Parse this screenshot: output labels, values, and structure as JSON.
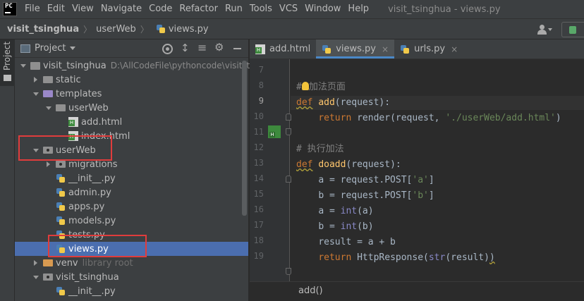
{
  "menubar": {
    "items": [
      "File",
      "Edit",
      "View",
      "Navigate",
      "Code",
      "Refactor",
      "Run",
      "Tools",
      "VCS",
      "Window",
      "Help"
    ],
    "window_title": "visit_tsinghua - views.py",
    "logo_text": "PC"
  },
  "breadcrumb": {
    "project": "visit_tsinghua",
    "folder": "userWeb",
    "file": "views.py"
  },
  "project_panel": {
    "title": "Project",
    "tool_tab_label": "Project",
    "tree": [
      {
        "label": "visit_tsinghua",
        "hint": "D:\\AllCodeFile\\pythoncode\\visit_ts",
        "depth": 0,
        "arrow": "down",
        "icon": "folder-root"
      },
      {
        "label": "static",
        "depth": 1,
        "arrow": "right",
        "icon": "folder"
      },
      {
        "label": "templates",
        "depth": 1,
        "arrow": "down",
        "icon": "folder-purple"
      },
      {
        "label": "userWeb",
        "depth": 2,
        "arrow": "down",
        "icon": "folder"
      },
      {
        "label": "add.html",
        "depth": 3,
        "arrow": "none",
        "icon": "html"
      },
      {
        "label": "index.html",
        "depth": 3,
        "arrow": "none",
        "icon": "html"
      },
      {
        "label": "userWeb",
        "depth": 1,
        "arrow": "down",
        "icon": "folder-pkg"
      },
      {
        "label": "migrations",
        "depth": 2,
        "arrow": "right",
        "icon": "folder-pkg"
      },
      {
        "label": "__init__.py",
        "depth": 2,
        "arrow": "none",
        "icon": "py"
      },
      {
        "label": "admin.py",
        "depth": 2,
        "arrow": "none",
        "icon": "py"
      },
      {
        "label": "apps.py",
        "depth": 2,
        "arrow": "none",
        "icon": "py"
      },
      {
        "label": "models.py",
        "depth": 2,
        "arrow": "none",
        "icon": "py"
      },
      {
        "label": "tests.py",
        "depth": 2,
        "arrow": "none",
        "icon": "py"
      },
      {
        "label": "views.py",
        "depth": 2,
        "arrow": "none",
        "icon": "py",
        "selected": true
      },
      {
        "label": "venv",
        "hint": "library root",
        "depth": 1,
        "arrow": "right",
        "icon": "folder-orange"
      },
      {
        "label": "visit_tsinghua",
        "depth": 1,
        "arrow": "down",
        "icon": "folder-pkg"
      },
      {
        "label": "__init__.py",
        "depth": 2,
        "arrow": "none",
        "icon": "py"
      }
    ]
  },
  "editor": {
    "tabs": [
      {
        "label": "add.html",
        "icon": "html",
        "active": false,
        "closable": false
      },
      {
        "label": "views.py",
        "icon": "py",
        "active": true,
        "closable": true
      },
      {
        "label": "urls.py",
        "icon": "py",
        "active": false,
        "closable": true
      }
    ],
    "close_glyph": "×",
    "line_numbers": [
      "7",
      "8",
      "9",
      "10",
      "11",
      "12",
      "13",
      "14",
      "15",
      "16",
      "17",
      "18",
      "19"
    ],
    "code": {
      "l8_comment_hash": "#",
      "l8_comment_text": "加法页面",
      "l9_def": "def",
      "l9_name": "add",
      "l9_rest": "(request):",
      "l10_return": "return",
      "l10_call": " render(request, ",
      "l10_str": "'./userWeb/add.html'",
      "l10_end": ")",
      "l12_comment": "# 执行加法",
      "l13_def": "def",
      "l13_name": "doadd",
      "l13_rest": "(request):",
      "l14_a": "a = request.POST[",
      "l14_str": "'a'",
      "l14_end": "]",
      "l15_a": "b = request.POST[",
      "l15_str": "'b'",
      "l15_end": "]",
      "l16_a": "a = ",
      "l16_int": "int",
      "l16_end": "(a)",
      "l17_a": "b = ",
      "l17_int": "int",
      "l17_end": "(b)",
      "l18": "result = a + b",
      "l19_return": "return",
      "l19_a": " HttpResponse(",
      "l19_str": "str",
      "l19_end": "(result)",
      "l19_close": ")"
    },
    "status_breadcrumb": "add()"
  },
  "colors": {
    "selection": "#4b6eaf",
    "annotation": "#e03c3c",
    "keyword": "#cc7832",
    "function": "#ffc66d",
    "string": "#6a8759"
  }
}
